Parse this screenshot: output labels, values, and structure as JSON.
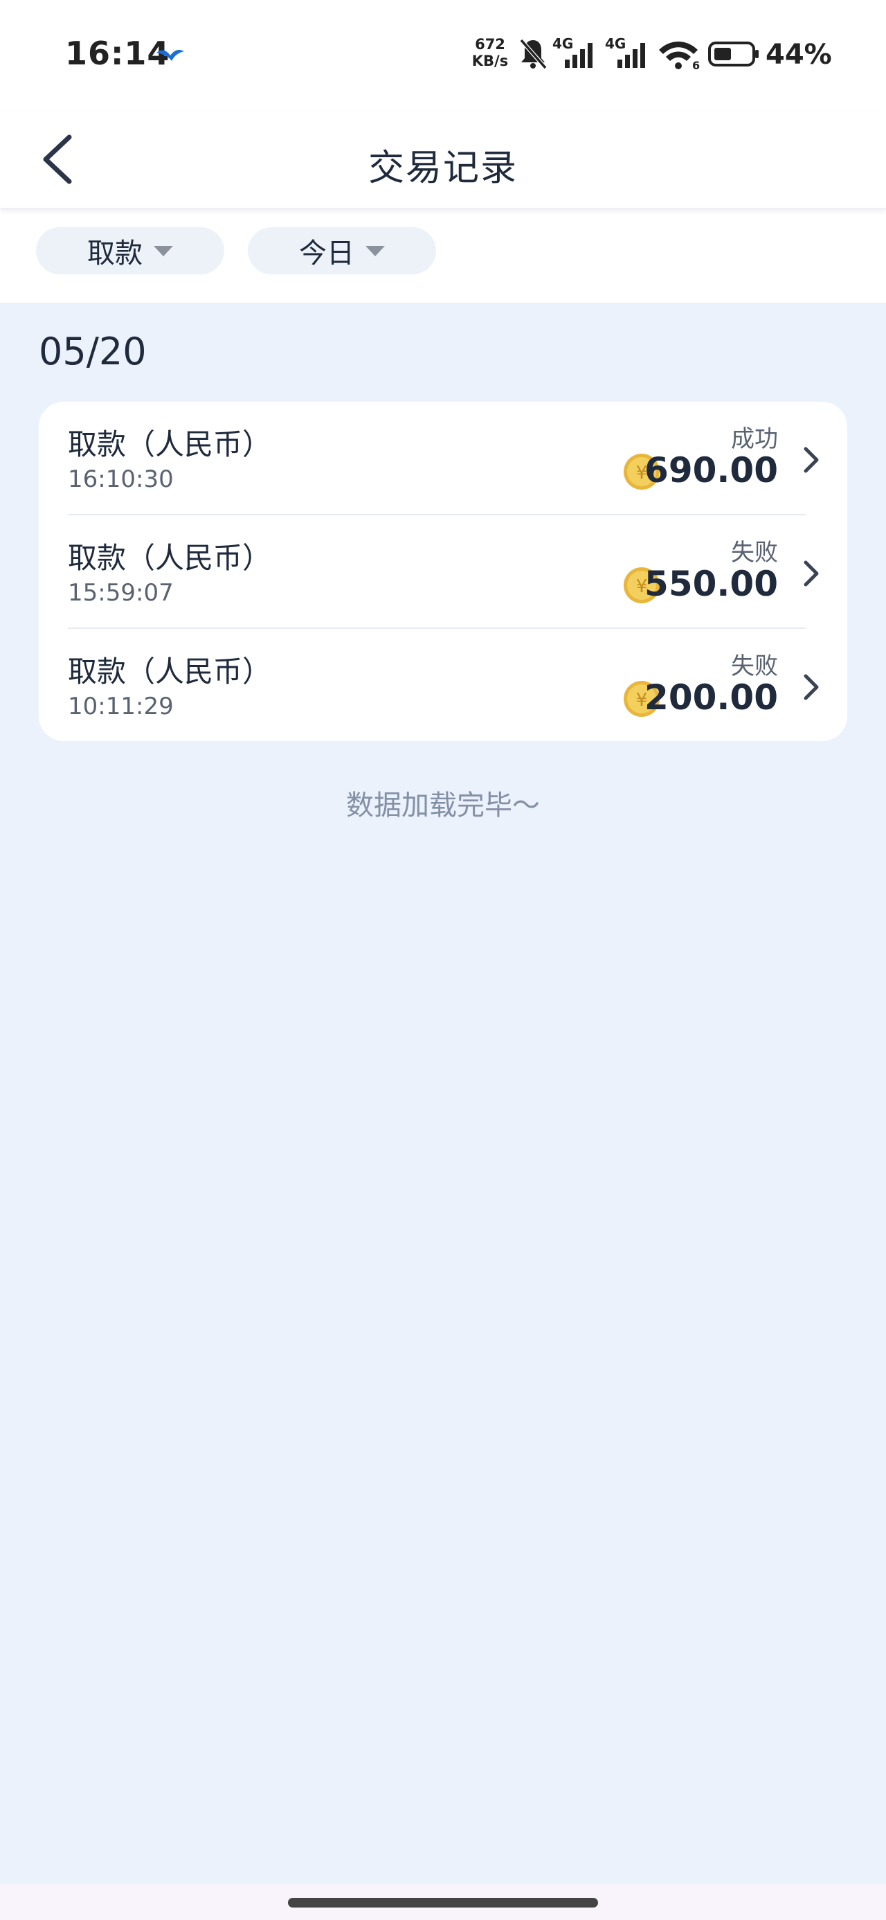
{
  "status_bar": {
    "time": "16:14",
    "net_speed_value": "672",
    "net_speed_unit": "KB/s",
    "signal_label_1": "4G",
    "signal_label_2": "4G",
    "wifi_label": "6",
    "battery_level": "44%"
  },
  "header": {
    "title": "交易记录"
  },
  "filters": {
    "type_label": "取款",
    "date_label": "今日"
  },
  "section": {
    "date": "05/20"
  },
  "transactions": [
    {
      "title": "取款（人民币）",
      "time": "16:10:30",
      "status": "成功",
      "amount": "690.00"
    },
    {
      "title": "取款（人民币）",
      "time": "15:59:07",
      "status": "失败",
      "amount": "550.00"
    },
    {
      "title": "取款（人民币）",
      "time": "10:11:29",
      "status": "失败",
      "amount": "200.00"
    }
  ],
  "footer": {
    "load_complete": "数据加载完毕～"
  },
  "colors": {
    "page_background": "#ebf2fc",
    "primary_text": "#1f2a3c",
    "coin_gold": "#e2b43c"
  },
  "icons": {
    "back": "chevron-left-icon",
    "row_arrow": "chevron-right-icon",
    "currency": "yuan-coin-icon",
    "filter_caret": "caret-down-icon"
  }
}
